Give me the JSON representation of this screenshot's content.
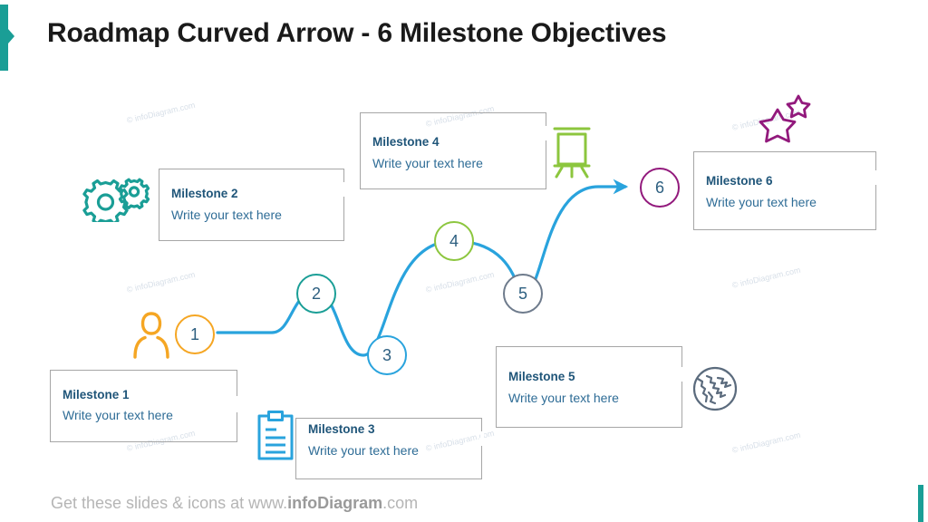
{
  "slide": {
    "title": "Roadmap Curved Arrow - 6 Milestone Objectives",
    "background_color": "#ffffff",
    "accent_color": "#1a9e96"
  },
  "footer": {
    "prefix": "Get these slides & icons at www.",
    "brand": "infoDiagram",
    "suffix": ".com"
  },
  "arrow": {
    "color": "#29a3dd",
    "description": "serpentine-curved-arrow"
  },
  "milestones": [
    {
      "number": "1",
      "title": "Milestone 1",
      "subtitle": "Write your text here",
      "circle_color": "#f5a623",
      "icon": "person-icon",
      "icon_color": "#f5a623"
    },
    {
      "number": "2",
      "title": "Milestone 2",
      "subtitle": "Write your text here",
      "circle_color": "#1a9e96",
      "icon": "gears-icon",
      "icon_color": "#1a9e96"
    },
    {
      "number": "3",
      "title": "Milestone 3",
      "subtitle": "Write your text here",
      "circle_color": "#29a3dd",
      "icon": "clipboard-icon",
      "icon_color": "#29a3dd"
    },
    {
      "number": "4",
      "title": "Milestone 4",
      "subtitle": "Write your text here",
      "circle_color": "#8cc63e",
      "icon": "easel-icon",
      "icon_color": "#8cc63e"
    },
    {
      "number": "5",
      "title": "Milestone 5",
      "subtitle": "Write your text here",
      "circle_color": "#6e7b8c",
      "icon": "globe-icon",
      "icon_color": "#5b6b7d"
    },
    {
      "number": "6",
      "title": "Milestone 6",
      "subtitle": "Write your text here",
      "circle_color": "#92197c",
      "icon": "stars-icon",
      "icon_color": "#92197c"
    }
  ],
  "watermarks": [
    {
      "text": "© infoDiagram.com"
    },
    {
      "text": "© infoDiagram.com"
    },
    {
      "text": "© infoDiagram.com"
    },
    {
      "text": "© infoDiagram.com"
    },
    {
      "text": "© infoDiagram.com"
    },
    {
      "text": "© infoDiagram.com"
    },
    {
      "text": "© infoDiagram.com"
    },
    {
      "text": "© infoDiagram.com"
    },
    {
      "text": "© infoDiagram.com"
    }
  ]
}
